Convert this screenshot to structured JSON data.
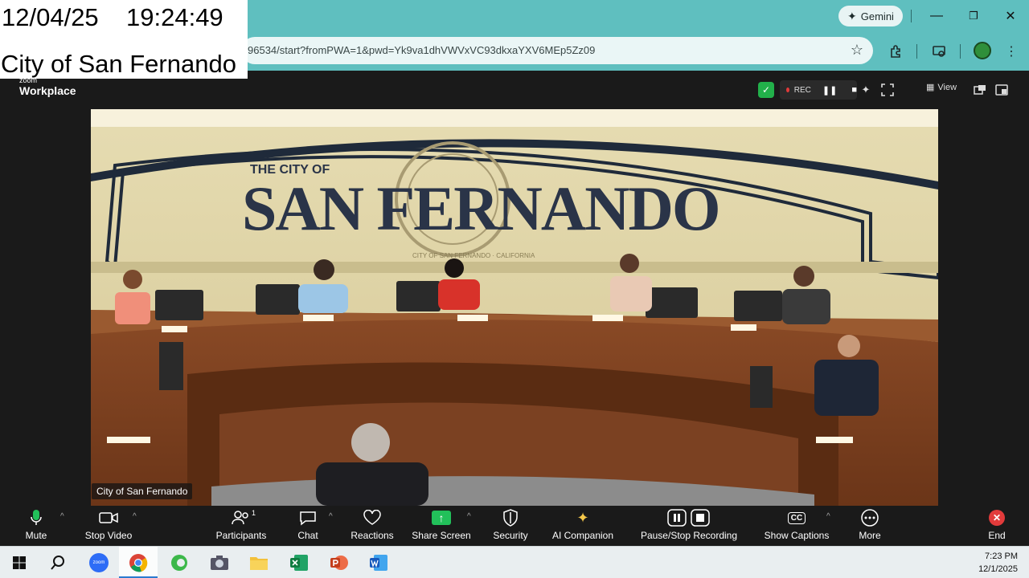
{
  "overlay": {
    "date": "12/04/25",
    "time": "19:24:49",
    "city": "City of San Fernando"
  },
  "browser": {
    "gemini_label": "Gemini",
    "url": "96534/start?fromPWA=1&pwd=Yk9va1dhVWVxVC93dkxaYXV6MEp5Zz09"
  },
  "zoom": {
    "brand_small": "zoom",
    "brand": "Workplace",
    "rec_label": "REC",
    "view_label": "View",
    "video_label": "City of San Fernando",
    "sign": {
      "line1": "THE CITY OF",
      "line2": "SAN FERNANDO",
      "seal_text": "CITY OF SAN FERNANDO · CALIFORNIA"
    },
    "toolbar": {
      "mute": "Mute",
      "stop_video": "Stop Video",
      "participants": "Participants",
      "participants_count": "1",
      "chat": "Chat",
      "reactions": "Reactions",
      "share_screen": "Share Screen",
      "security": "Security",
      "ai_companion": "AI Companion",
      "pause_stop_recording": "Pause/Stop Recording",
      "show_captions": "Show Captions",
      "captions_badge": "CC",
      "more": "More",
      "end": "End"
    }
  },
  "taskbar": {
    "time": "7:23 PM",
    "date": "12/1/2025",
    "zoom_icon_text": "zoom"
  },
  "colors": {
    "browser_frame": "#5fbfbf",
    "zoom_bg": "#1a1a1a",
    "share_green": "#22c05a",
    "end_red": "#e23b3b",
    "security_green": "#22b04a"
  }
}
